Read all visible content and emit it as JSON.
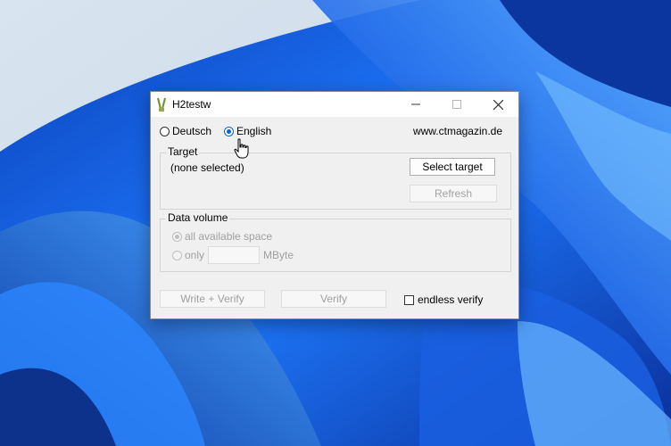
{
  "window": {
    "title": "H2testw"
  },
  "language": {
    "options": [
      {
        "label": "Deutsch",
        "selected": false
      },
      {
        "label": "English",
        "selected": true
      }
    ],
    "website": "www.ctmagazin.de"
  },
  "target": {
    "group_label": "Target",
    "selection_text": "(none selected)",
    "select_button": "Select target",
    "refresh_button": "Refresh"
  },
  "data_volume": {
    "group_label": "Data volume",
    "all_space_label": "all available space",
    "only_label": "only",
    "only_value": "",
    "unit_label": "MByte"
  },
  "actions": {
    "write_verify": "Write + Verify",
    "verify": "Verify",
    "endless_verify": "endless verify"
  },
  "colors": {
    "accent": "#0a64c8",
    "wallpaper": "#2f6fd8",
    "window_bg": "#f0f0f0"
  },
  "icons": {
    "app": "h2testw-app-icon",
    "cursor": "hand-pointer-icon"
  }
}
